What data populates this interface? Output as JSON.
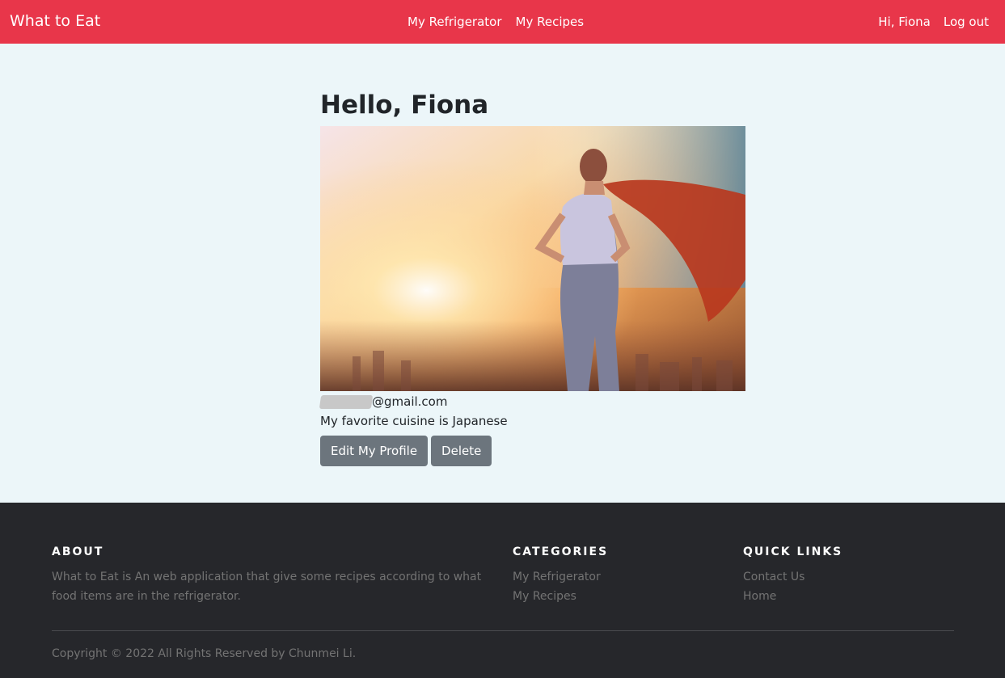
{
  "nav": {
    "brand": "What to Eat",
    "links": [
      "My Refrigerator",
      "My Recipes"
    ],
    "greeting": "Hi, Fiona",
    "logout": "Log out"
  },
  "profile": {
    "heading": "Hello, Fiona",
    "email_suffix": "@gmail.com",
    "cuisine_text": "My favorite cuisine is Japanese",
    "edit_button": "Edit My Profile",
    "delete_button": "Delete"
  },
  "footer": {
    "about_heading": "ABOUT",
    "about_text": "What to Eat is An web application that give some recipes according to what food items are in the refrigerator.",
    "categories_heading": "CATEGORIES",
    "categories": [
      "My Refrigerator",
      "My Recipes"
    ],
    "quicklinks_heading": "QUICK LINKS",
    "quicklinks": [
      "Contact Us",
      "Home"
    ],
    "copyright": "Copyright © 2022 All Rights Reserved by Chunmei Li."
  },
  "colors": {
    "navbar": "#e8364a",
    "page_bg": "#ecf6f9",
    "footer_bg": "#26272b",
    "button": "#6c757d"
  }
}
